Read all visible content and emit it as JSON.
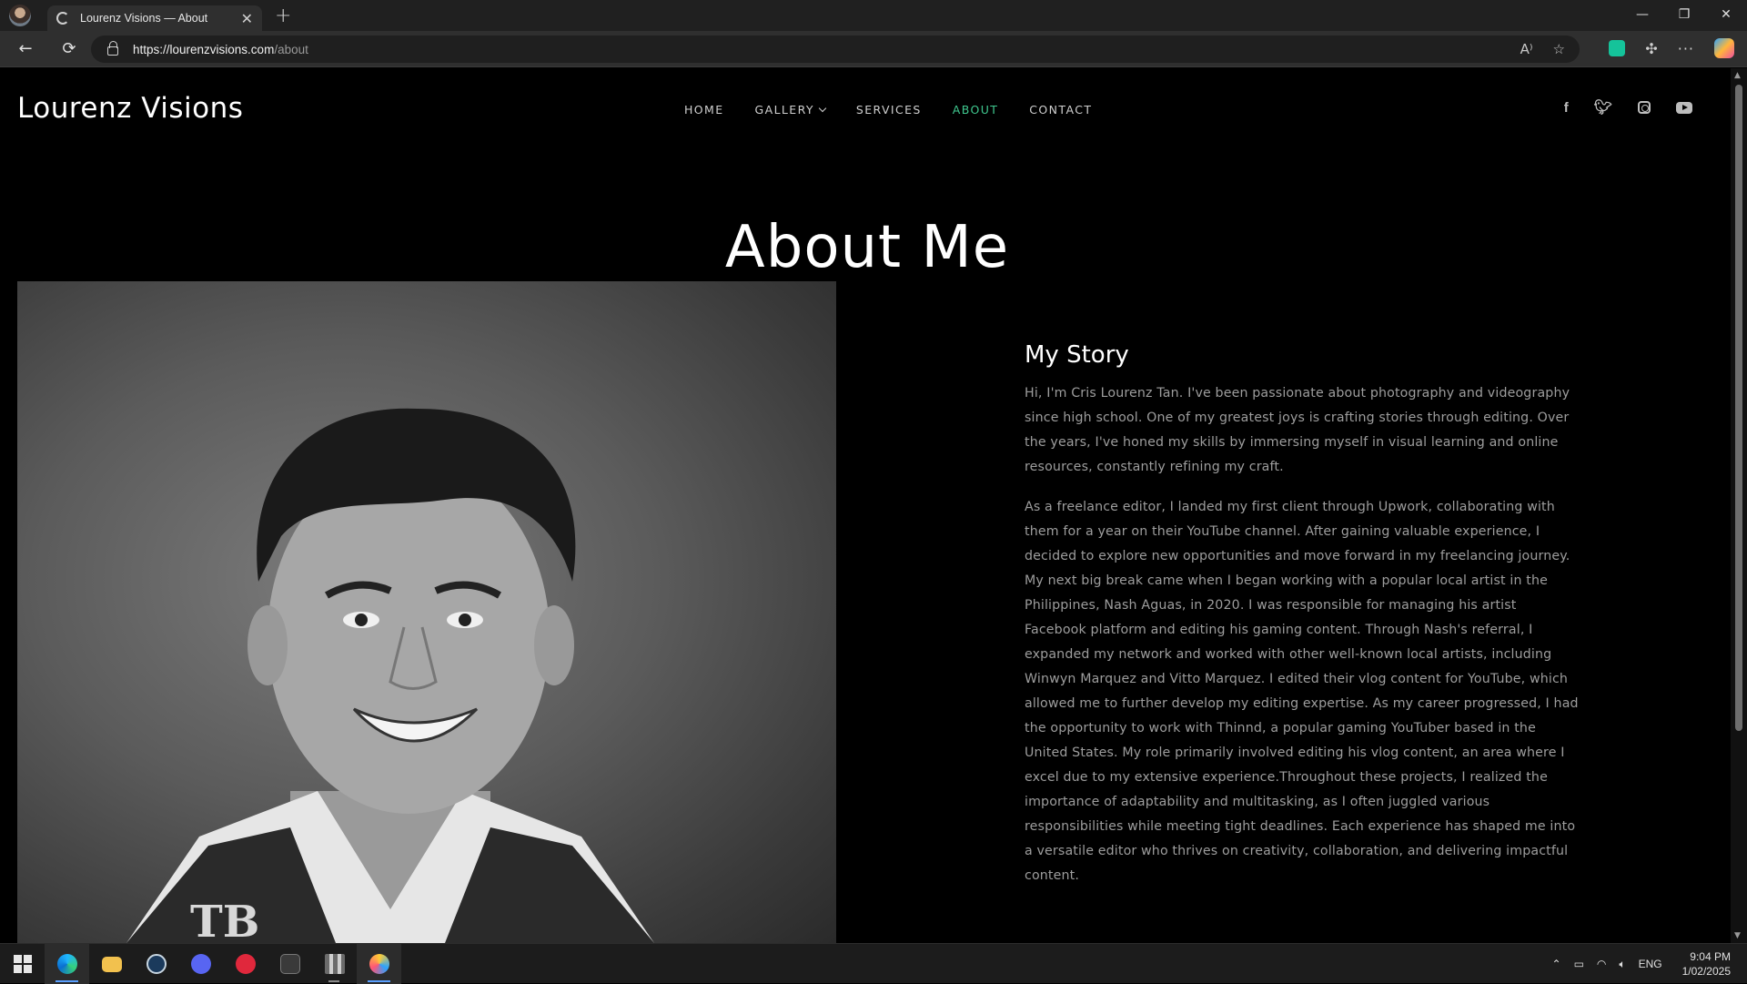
{
  "browser": {
    "tab_title": "Lourenz Visions — About",
    "url_host": "https://lourenzvisions.com",
    "url_path": "/about",
    "new_tab_glyph": "+",
    "close_tab_glyph": "✕",
    "window_controls": [
      "—",
      "❐",
      "✕"
    ]
  },
  "site": {
    "logo": "Lourenz Visions",
    "nav": [
      {
        "label": "HOME",
        "active": false
      },
      {
        "label": "GALLERY",
        "active": false,
        "dropdown": true
      },
      {
        "label": "SERVICES",
        "active": false
      },
      {
        "label": "ABOUT",
        "active": true
      },
      {
        "label": "CONTACT",
        "active": false
      }
    ],
    "socials": [
      "facebook-icon",
      "twitter-icon",
      "instagram-icon",
      "youtube-icon"
    ],
    "accent_color": "#3fc88f"
  },
  "about": {
    "page_title": "About Me",
    "story_heading": "My Story",
    "paragraph_1": "Hi, I'm Cris Lourenz Tan. I've been passionate about photography and videography since high school. One of my greatest joys is crafting stories through editing. Over the years, I've honed my skills by immersing myself in visual learning and online resources, constantly refining my craft.",
    "paragraph_2": "As a freelance editor, I landed my first client through Upwork, collaborating with them for a year on their YouTube channel. After gaining valuable experience, I decided to explore new opportunities and move forward in my freelancing journey. My next big break came when I began working with a popular local artist in the Philippines, Nash Aguas, in 2020. I was responsible for managing his artist Facebook platform and editing his gaming content. Through Nash's referral, I expanded my network and worked with other well-known local artists, including Winwyn Marquez and Vitto Marquez. I edited their vlog content for YouTube, which allowed me to further develop my editing expertise. As my career progressed, I had the opportunity to work with Thinnd, a popular gaming YouTuber based in the United States. My role primarily involved editing his vlog content, an area where I excel due to my extensive experience.Throughout these projects, I realized the importance of adaptability and multitasking, as I often juggled various responsibilities while meeting tight deadlines. Each experience has shaped me into a versatile editor who thrives on creativity, collaboration, and delivering impactful content."
  },
  "taskbar": {
    "language": "ENG",
    "time": "9:04 PM",
    "date": "1/02/2025"
  }
}
